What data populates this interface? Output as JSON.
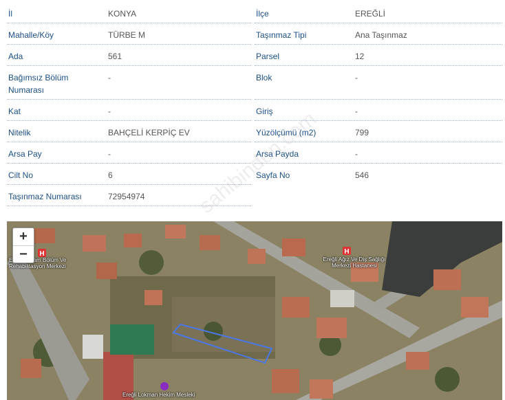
{
  "fields": [
    {
      "label": "İl",
      "value": "KONYA",
      "label2": "İlçe",
      "value2": "EREĞLİ"
    },
    {
      "label": "Mahalle/Köy",
      "value": "TÜRBE M",
      "label2": "Taşınmaz Tipi",
      "value2": "Ana Taşınmaz"
    },
    {
      "label": "Ada",
      "value": "561",
      "label2": "Parsel",
      "value2": "12"
    },
    {
      "label": "Bağımsız Bölüm Numarası",
      "value": "-",
      "label2": "Blok",
      "value2": "-"
    },
    {
      "label": "Kat",
      "value": "-",
      "label2": "Giriş",
      "value2": "-"
    },
    {
      "label": "Nitelik",
      "value": "BAHÇELİ KERPİÇ EV",
      "label2": "Yüzölçümü (m2)",
      "value2": "799"
    },
    {
      "label": "Arsa Pay",
      "value": "-",
      "label2": "Arsa Payda",
      "value2": "-"
    },
    {
      "label": "Cilt No",
      "value": "6",
      "label2": "Sayfa No",
      "value2": "546"
    },
    {
      "label": "Taşınmaz Numarası",
      "value": "72954974"
    }
  ],
  "watermark": "sahibinden.com",
  "map": {
    "zoom_in": "+",
    "zoom_out": "−",
    "labels": {
      "rehab": "Ereğli Yaşam Bölüm Ve Rehabilitasyon Merkezi",
      "dental": "Ereğli Ağız Ve Diş Sağlığı Merkezi Hastanesi",
      "school": "Ereğli Lokman Hekim Mesleki"
    },
    "parcel_color": "#4a78e8",
    "hospital_color": "#e03333",
    "school_pin_color": "#8a2cc2"
  }
}
